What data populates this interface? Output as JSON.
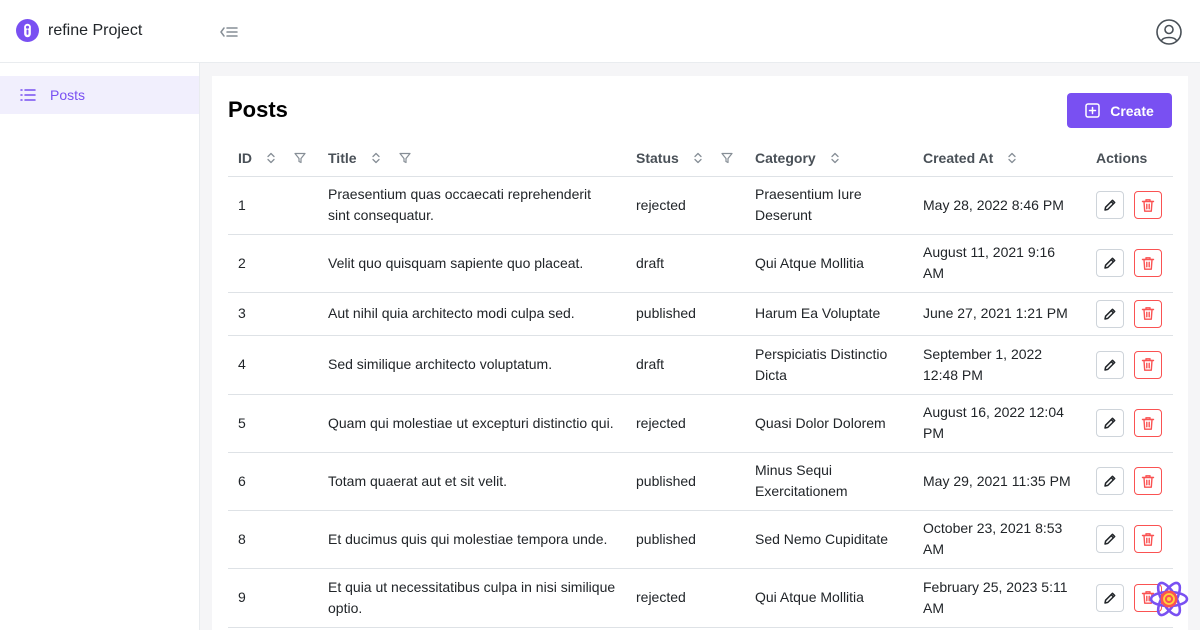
{
  "app": {
    "title": "refine Project"
  },
  "sidebar": {
    "items": [
      {
        "label": "Posts",
        "icon": "list-icon",
        "active": true
      }
    ]
  },
  "page": {
    "title": "Posts",
    "create_label": "Create"
  },
  "colors": {
    "accent": "#7950f2",
    "danger": "#fa5252",
    "active_bg": "#f1effd"
  },
  "table": {
    "columns": [
      "ID",
      "Title",
      "Status",
      "Category",
      "Created At",
      "Actions"
    ],
    "rows": [
      {
        "id": "1",
        "title": "Praesentium quas occaecati reprehenderit sint consequatur.",
        "status": "rejected",
        "category": "Praesentium Iure Deserunt",
        "created_at": "May 28, 2022 8:46 PM"
      },
      {
        "id": "2",
        "title": "Velit quo quisquam sapiente quo placeat.",
        "status": "draft",
        "category": "Qui Atque Mollitia",
        "created_at": "August 11, 2021 9:16 AM"
      },
      {
        "id": "3",
        "title": "Aut nihil quia architecto modi culpa sed.",
        "status": "published",
        "category": "Harum Ea Voluptate",
        "created_at": "June 27, 2021 1:21 PM"
      },
      {
        "id": "4",
        "title": "Sed similique architecto voluptatum.",
        "status": "draft",
        "category": "Perspiciatis Distinctio Dicta",
        "created_at": "September 1, 2022 12:48 PM"
      },
      {
        "id": "5",
        "title": "Quam qui molestiae ut excepturi distinctio qui.",
        "status": "rejected",
        "category": "Quasi Dolor Dolorem",
        "created_at": "August 16, 2022 12:04 PM"
      },
      {
        "id": "6",
        "title": "Totam quaerat aut et sit velit.",
        "status": "published",
        "category": "Minus Sequi Exercitationem",
        "created_at": "May 29, 2021 11:35 PM"
      },
      {
        "id": "8",
        "title": "Et ducimus quis qui molestiae tempora unde.",
        "status": "published",
        "category": "Sed Nemo Cupiditate",
        "created_at": "October 23, 2021 8:53 AM"
      },
      {
        "id": "9",
        "title": "Et quia ut necessitatibus culpa in nisi similique optio.",
        "status": "rejected",
        "category": "Qui Atque Mollitia",
        "created_at": "February 25, 2023 5:11 AM"
      }
    ]
  }
}
